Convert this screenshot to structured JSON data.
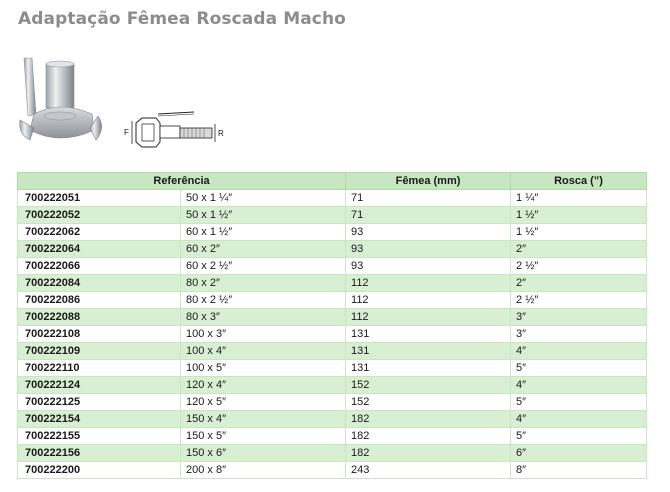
{
  "title": "Adaptação Fêmea Roscada Macho",
  "diagram": {
    "label_left": "F",
    "label_right": "R"
  },
  "table": {
    "headers": {
      "referencia": "Referência",
      "femea": "Fêmea (mm)",
      "rosca": "Rosca (”)"
    },
    "rows": [
      {
        "ref": "700222051",
        "size": "50 x 1 ¼″",
        "femea": "71",
        "rosca": "1 ¼″"
      },
      {
        "ref": "700222052",
        "size": "50 x 1 ½″",
        "femea": "71",
        "rosca": "1 ½″"
      },
      {
        "ref": "700222062",
        "size": "60 x 1 ½″",
        "femea": "93",
        "rosca": "1 ½″"
      },
      {
        "ref": "700222064",
        "size": "60 x 2″",
        "femea": "93",
        "rosca": "2″"
      },
      {
        "ref": "700222066",
        "size": "60 x 2 ½″",
        "femea": "93",
        "rosca": "2 ½″"
      },
      {
        "ref": "700222084",
        "size": "80 x 2″",
        "femea": "112",
        "rosca": "2″"
      },
      {
        "ref": "700222086",
        "size": "80 x 2 ½″",
        "femea": "112",
        "rosca": "2 ½″"
      },
      {
        "ref": "700222088",
        "size": "80 x 3″",
        "femea": "112",
        "rosca": "3″"
      },
      {
        "ref": "700222108",
        "size": "100 x 3″",
        "femea": "131",
        "rosca": "3″"
      },
      {
        "ref": "700222109",
        "size": "100 x 4″",
        "femea": "131",
        "rosca": "4″"
      },
      {
        "ref": "700222110",
        "size": "100 x 5″",
        "femea": "131",
        "rosca": "5″"
      },
      {
        "ref": "700222124",
        "size": "120 x 4″",
        "femea": "152",
        "rosca": "4″"
      },
      {
        "ref": "700222125",
        "size": "120 x 5″",
        "femea": "152",
        "rosca": "5″"
      },
      {
        "ref": "700222154",
        "size": "150 x 4″",
        "femea": "182",
        "rosca": "4″"
      },
      {
        "ref": "700222155",
        "size": "150 x 5″",
        "femea": "182",
        "rosca": "5″"
      },
      {
        "ref": "700222156",
        "size": "150 x 6″",
        "femea": "182",
        "rosca": "6″"
      },
      {
        "ref": "700222200",
        "size": "200 x 8″",
        "femea": "243",
        "rosca": "8″"
      }
    ]
  }
}
